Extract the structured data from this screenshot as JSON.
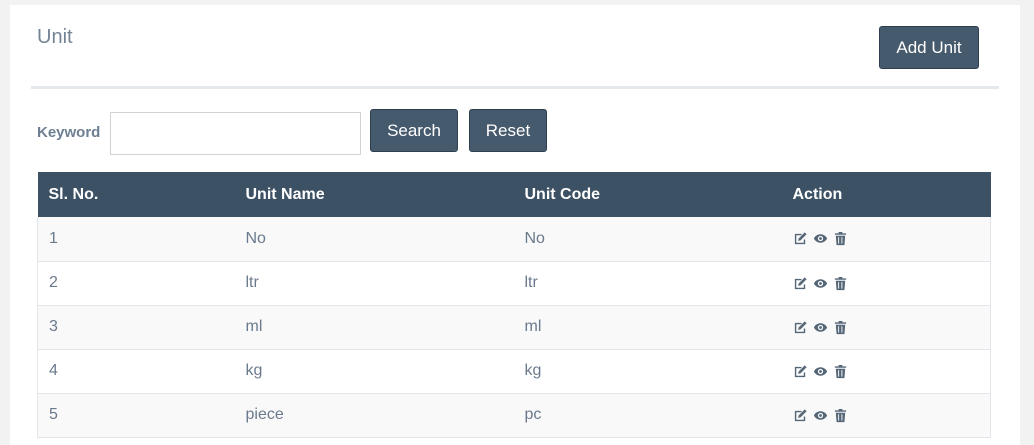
{
  "header": {
    "title": "Unit",
    "add_label": "Add Unit"
  },
  "filter": {
    "keyword_label": "Keyword",
    "keyword_value": "",
    "search_label": "Search",
    "reset_label": "Reset"
  },
  "table": {
    "columns": [
      "Sl. No.",
      "Unit Name",
      "Unit Code",
      "Action"
    ],
    "rows": [
      {
        "sl": "1",
        "name": "No",
        "code": "No"
      },
      {
        "sl": "2",
        "name": "ltr",
        "code": "ltr"
      },
      {
        "sl": "3",
        "name": "ml",
        "code": "ml"
      },
      {
        "sl": "4",
        "name": "kg",
        "code": "kg"
      },
      {
        "sl": "5",
        "name": "piece",
        "code": "pc"
      }
    ],
    "action_icons": [
      "edit-icon",
      "view-icon",
      "delete-icon"
    ]
  }
}
